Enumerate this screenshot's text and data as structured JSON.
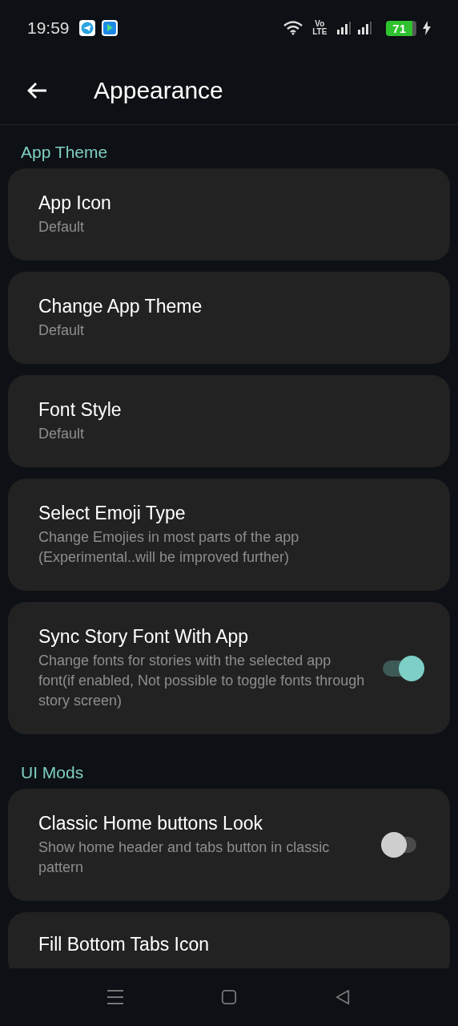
{
  "status_bar": {
    "time": "19:59",
    "network_label": "Vo LTE",
    "battery": "71"
  },
  "header": {
    "title": "Appearance"
  },
  "sections": [
    {
      "title": "App Theme",
      "items": [
        {
          "kind": "option",
          "title": "App Icon",
          "subtitle": "Default"
        },
        {
          "kind": "option",
          "title": "Change App Theme",
          "subtitle": "Default"
        },
        {
          "kind": "option",
          "title": "Font Style",
          "subtitle": "Default"
        },
        {
          "kind": "option",
          "title": "Select Emoji Type",
          "subtitle": "Change Emojies in most parts of the app (Experimental..will be improved further)"
        },
        {
          "kind": "switch",
          "title": "Sync Story Font With App",
          "subtitle": "Change fonts for stories with the selected app font(if enabled, Not possible to toggle fonts through story screen)",
          "on": true
        }
      ]
    },
    {
      "title": "UI Mods",
      "items": [
        {
          "kind": "switch",
          "title": "Classic Home buttons Look",
          "subtitle": "Show home header and tabs button in classic pattern",
          "on": false
        },
        {
          "kind": "option",
          "title": "Fill Bottom Tabs Icon"
        }
      ]
    }
  ]
}
